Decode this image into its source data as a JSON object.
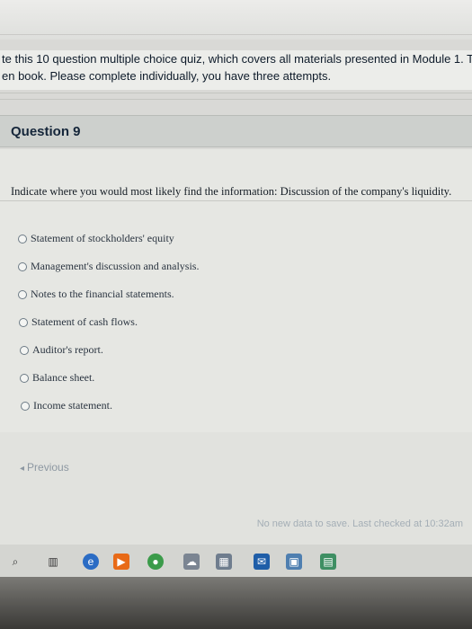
{
  "intro": {
    "line1": "te this 10 question multiple choice quiz, which covers all materials presented in Module 1. Th",
    "line2": "en book. Please complete individually, you have three attempts."
  },
  "question": {
    "title": "Question 9",
    "prompt": "Indicate where you would most likely find the information: Discussion of the company's liquidity.",
    "options": [
      "Statement of stockholders' equity",
      "Management's discussion and analysis.",
      "Notes to the financial statements.",
      "Statement of cash flows.",
      "Auditor's report.",
      "Balance sheet.",
      "Income statement."
    ]
  },
  "navigation": {
    "previous_label": "Previous"
  },
  "status": {
    "save_text": "No new data to save. Last checked at 10:32am"
  },
  "taskbar": {
    "icons": [
      "search-icon",
      "task-view-icon",
      "edge-icon",
      "media-icon",
      "chrome-icon",
      "weather-icon",
      "store-icon",
      "outlook-icon",
      "photos-icon",
      "notes-icon"
    ]
  }
}
